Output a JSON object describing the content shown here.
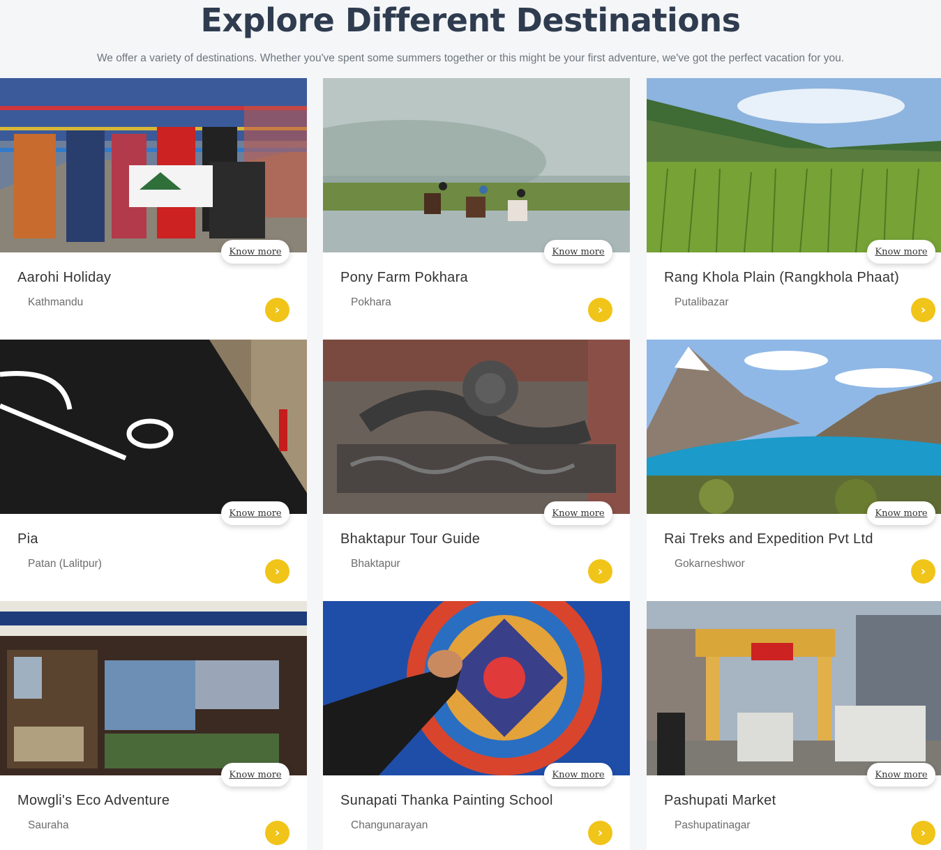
{
  "header": {
    "title": "Explore Different Destinations",
    "subtitle": "We offer a variety of destinations. Whether you've spent some summers together or this might be your first adventure, we've got the perfect vacation for you."
  },
  "know_more_label": "Know more",
  "accent_color": "#f0c419",
  "cards": [
    {
      "name": "Aarohi Holiday",
      "location": "Kathmandu",
      "image": "trekking-group-photo"
    },
    {
      "name": "Pony Farm Pokhara",
      "location": "Pokhara",
      "image": "horse-riders-photo"
    },
    {
      "name": "Rang Khola Plain (Rangkhola Phaat)",
      "location": "Putalibazar",
      "image": "rice-field-photo"
    },
    {
      "name": "Pia",
      "location": "Patan (Lalitpur)",
      "image": "pia-logo-photo"
    },
    {
      "name": "Bhaktapur Tour Guide",
      "location": "Bhaktapur",
      "image": "wood-carving-photo"
    },
    {
      "name": "Rai Treks and Expedition Pvt Ltd",
      "location": "Gokarneshwor",
      "image": "mountain-lake-photo"
    },
    {
      "name": "Mowgli's Eco Adventure",
      "location": "Sauraha",
      "image": "shop-front-photo"
    },
    {
      "name": "Sunapati Thanka Painting School",
      "location": "Changunarayan",
      "image": "mandala-painting-photo"
    },
    {
      "name": "Pashupati Market",
      "location": "Pashupatinagar",
      "image": "market-street-photo"
    }
  ]
}
